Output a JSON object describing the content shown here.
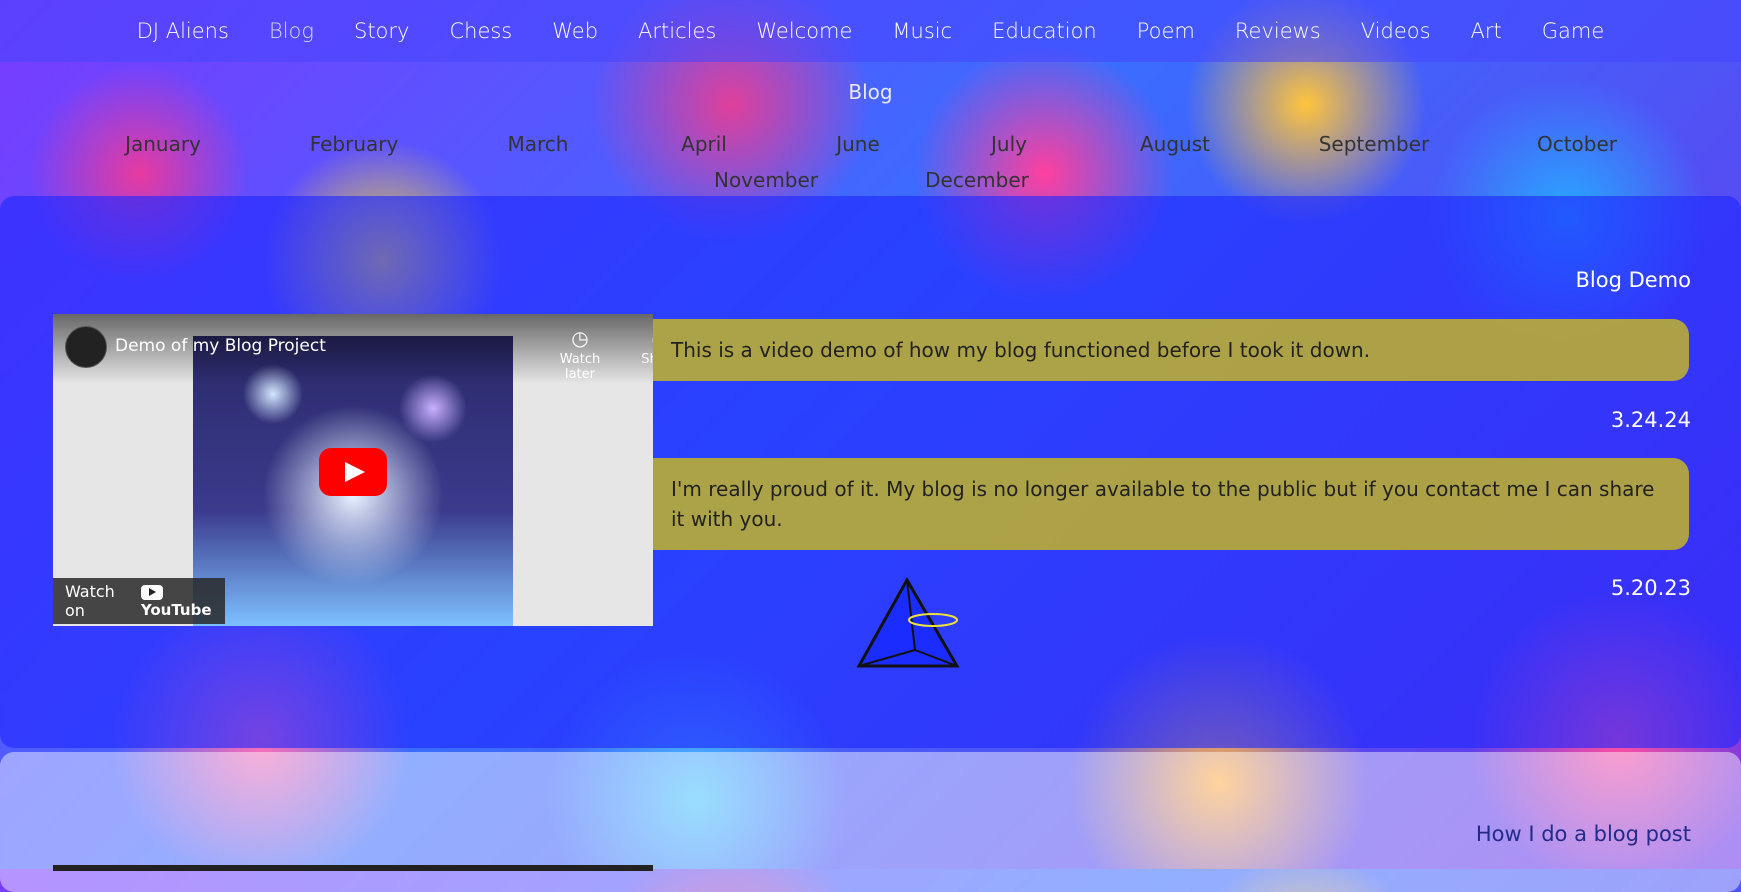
{
  "nav": {
    "items": [
      "DJ Aliens",
      "Blog",
      "Story",
      "Chess",
      "Web",
      "Articles",
      "Welcome",
      "Music",
      "Education",
      "Poem",
      "Reviews",
      "Videos",
      "Art",
      "Game"
    ],
    "active": "Blog"
  },
  "blog_heading": "Blog",
  "months": [
    "January",
    "February",
    "March",
    "April",
    "June",
    "July",
    "August",
    "September",
    "October",
    "November",
    "December"
  ],
  "post1": {
    "title": "Blog Demo",
    "video": {
      "title": "Demo of my Blog Project",
      "watch_later": "Watch later",
      "share": "Share",
      "watch_on": "Watch on",
      "brand": "YouTube"
    },
    "entries": [
      {
        "text": "This is a video demo of how my blog functioned before I took it down.",
        "date": "3.24.24"
      },
      {
        "text": "I'm really proud of it. My blog is no longer available to the public but if you contact me I can share it with you.",
        "date": "5.20.23"
      }
    ]
  },
  "post2": {
    "title": "How I do a blog post"
  },
  "colors": {
    "nav_bg": "#4646ff",
    "panel_blue": "#1e28ff",
    "bubble": "#c3b428"
  }
}
